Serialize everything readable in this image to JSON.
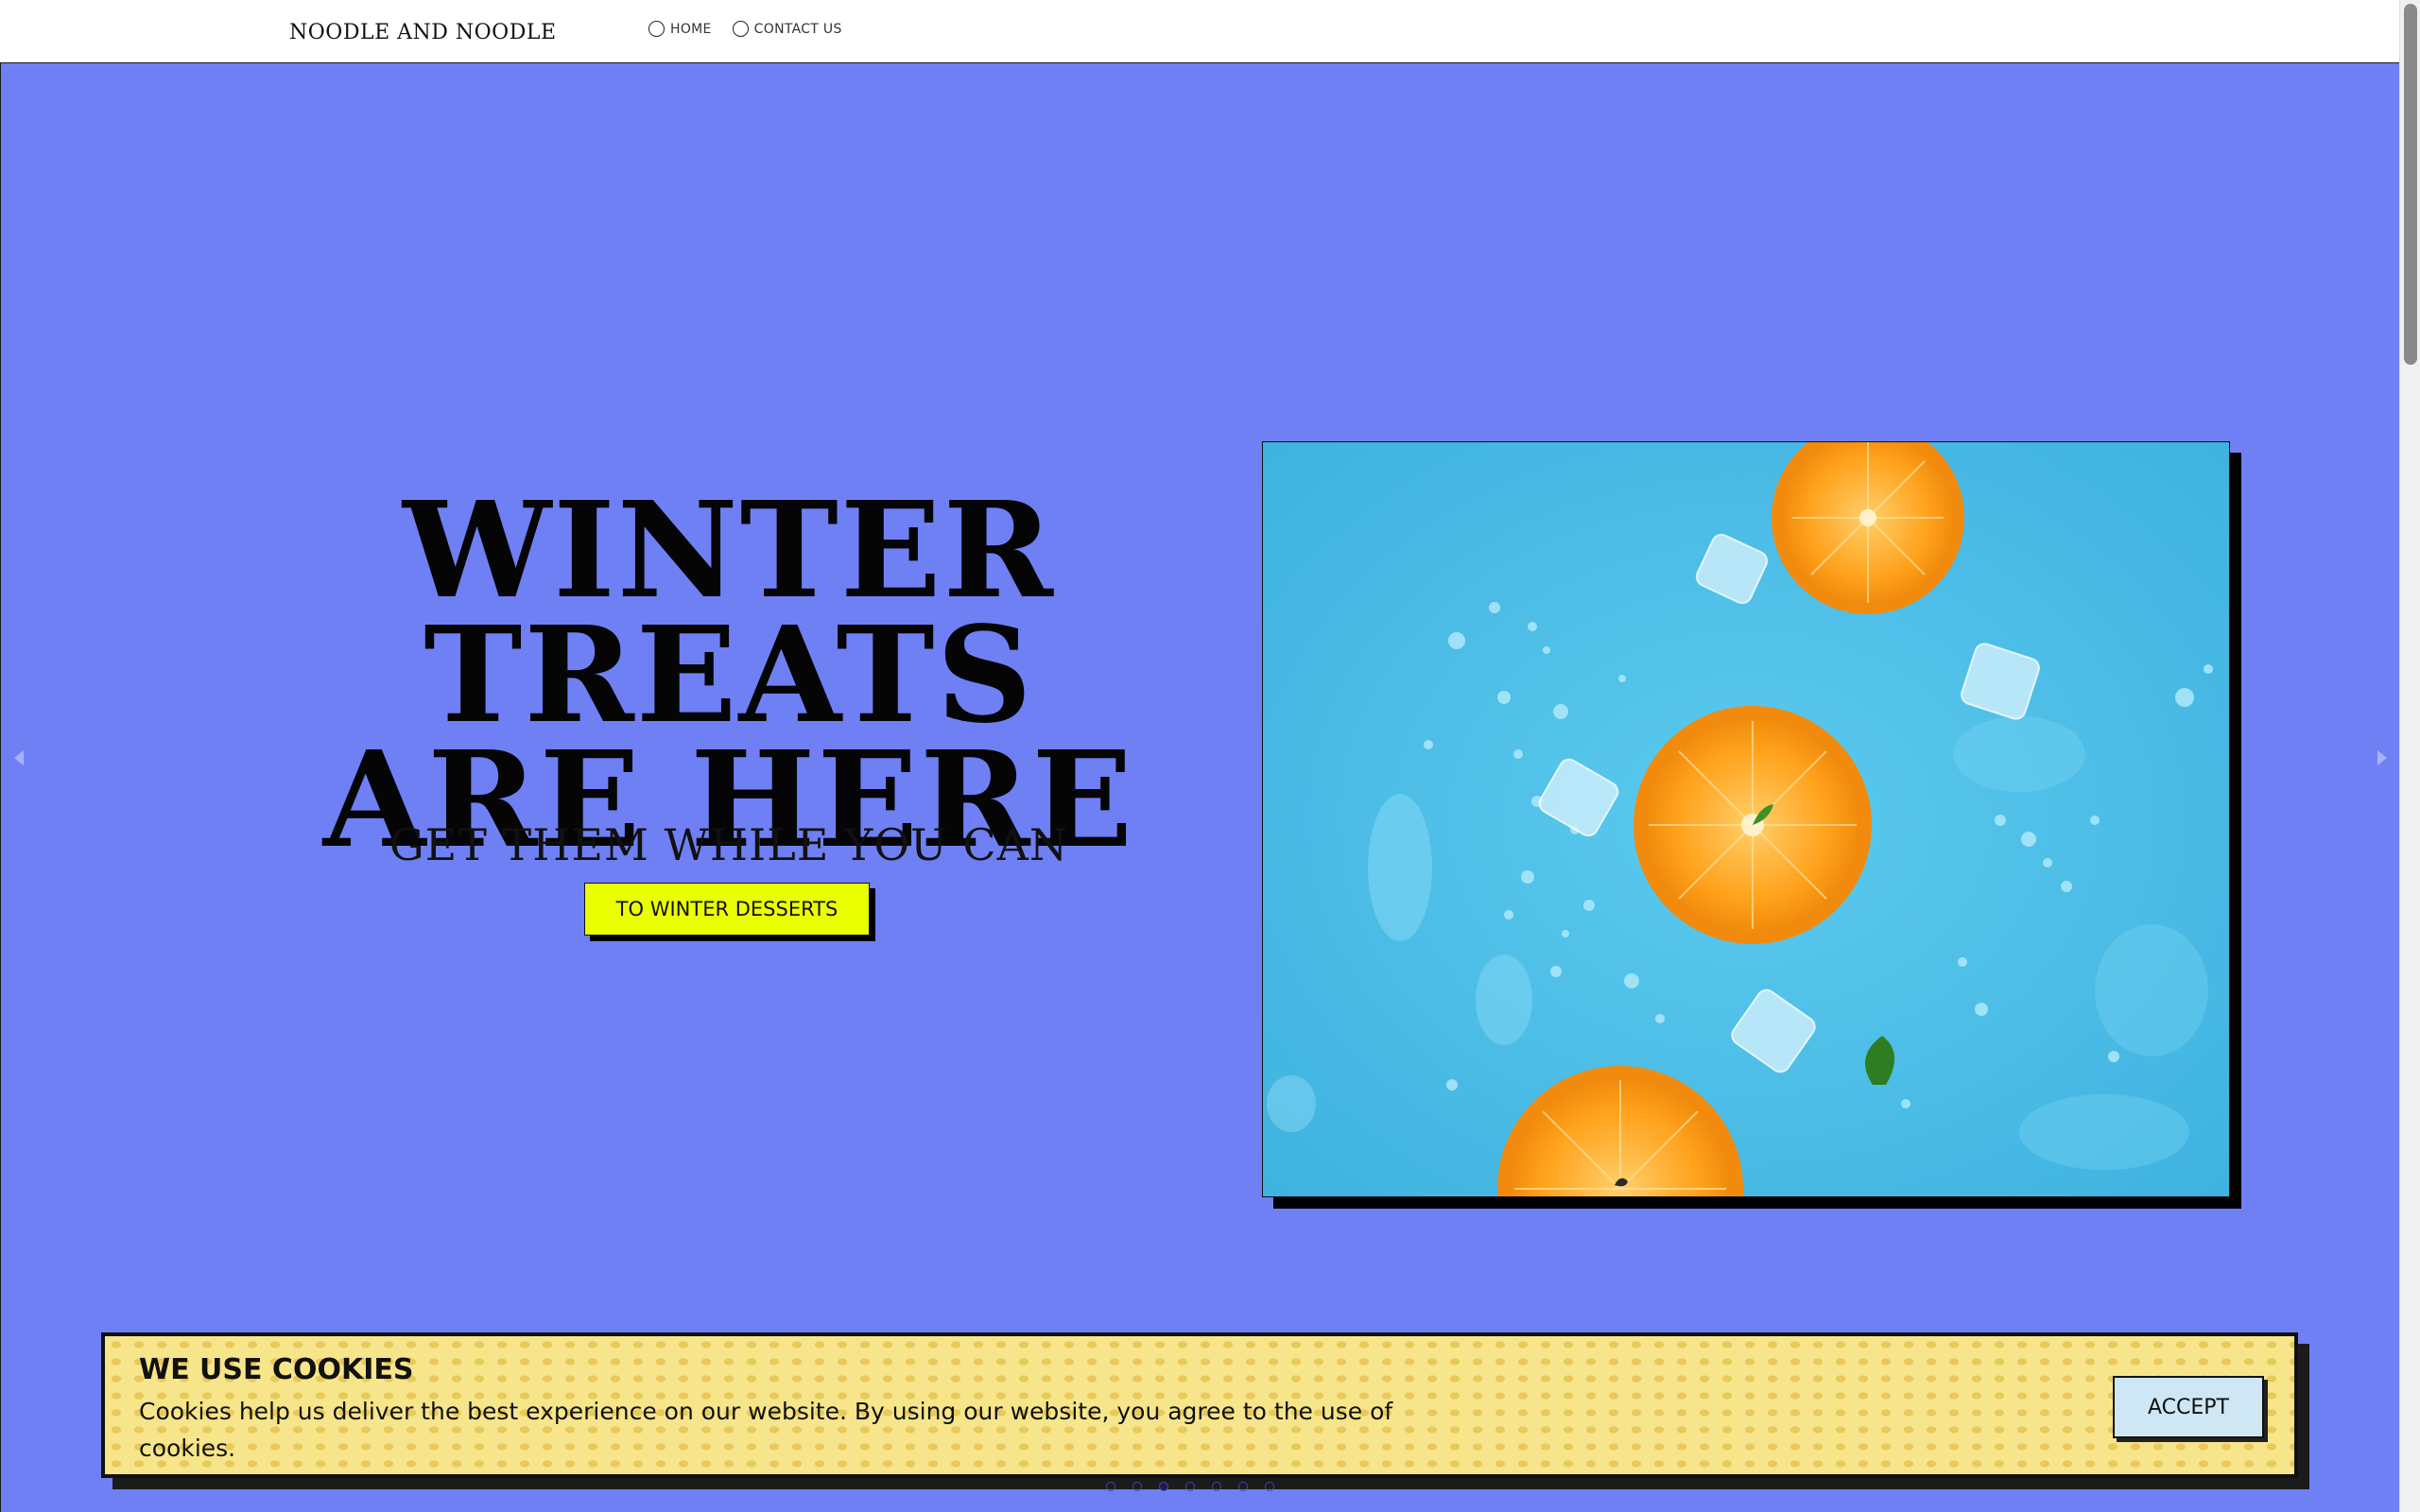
{
  "header": {
    "brand": "NOODLE AND NOODLE",
    "nav": [
      {
        "label": "HOME"
      },
      {
        "label": "CONTACT US"
      }
    ]
  },
  "hero": {
    "headline_line1": "WINTER TREATS",
    "headline_line2": "ARE HERE",
    "subhead": "GET THEM WHILE YOU CAN",
    "cta_label": "TO WINTER DESSERTS",
    "background_color": "#6f80f4",
    "cta_color": "#eaff00",
    "prev_icon": "chevron-left-icon",
    "next_icon": "chevron-right-icon",
    "image_subject": "orange slices and ice cubes on blue background"
  },
  "cookie_banner": {
    "title": "WE USE COOKIES",
    "text": "Cookies help us deliver the best experience on our website. By using our website, you agree to the use of cookies.",
    "accept_label": "ACCEPT"
  },
  "carousel": {
    "slide_count": 7,
    "active_index": 2
  }
}
